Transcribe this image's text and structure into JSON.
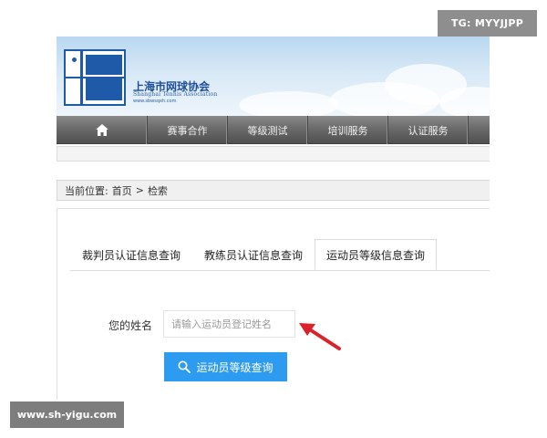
{
  "header": {
    "org_name_cn": "上海市网球协会",
    "org_name_en": "Shanghai Tennis Association",
    "org_url": "www.sbwsqxh.com"
  },
  "nav": {
    "home_icon": "home-icon",
    "items": [
      "赛事合作",
      "等级测试",
      "培训服务",
      "认证服务"
    ]
  },
  "breadcrumb": {
    "label": "当前位置:",
    "home": "首页",
    "separator": ">",
    "current": "检索"
  },
  "tabs": [
    {
      "label": "裁判员认证信息查询",
      "active": false
    },
    {
      "label": "教练员认证信息查询",
      "active": false
    },
    {
      "label": "运动员等级信息查询",
      "active": true
    }
  ],
  "form": {
    "name_label": "您的姓名",
    "name_placeholder": "请输入运动员登记姓名",
    "search_button": "运动员等级查询",
    "search_icon": "search-icon"
  },
  "watermarks": {
    "top_right": "TG: MYYJJPP",
    "bottom_left": "www.sh-yigu.com"
  },
  "colors": {
    "brand_blue": "#1e5aa8",
    "button_blue": "#2d9cf0",
    "arrow_red": "#d8232a",
    "nav_gray": "#6b6b6b"
  }
}
